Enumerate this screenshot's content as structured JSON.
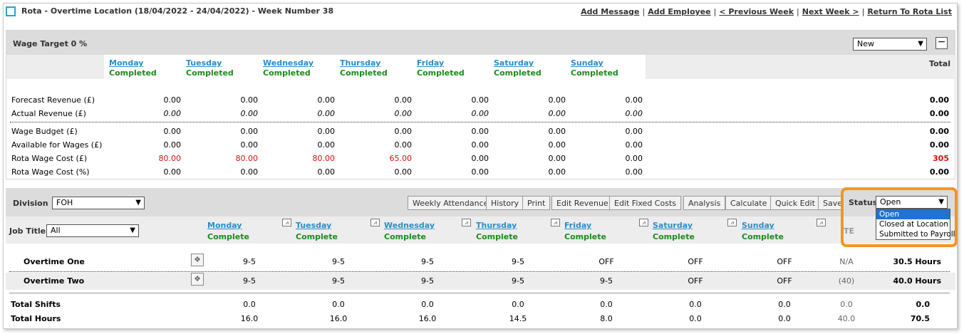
{
  "header": {
    "title": "Rota - Overtime Location (18/04/2022 - 24/04/2022) - Week Number 38",
    "links": [
      "Add Message",
      "Add Employee",
      "< Previous Week",
      "Next Week >",
      "Return To Rota List"
    ]
  },
  "wage_panel": {
    "title": "Wage Target 0 %",
    "view_select": "New",
    "minimize_symbol": "−",
    "total_label": "Total",
    "days": [
      {
        "name": "Monday",
        "status": "Completed"
      },
      {
        "name": "Tuesday",
        "status": "Completed"
      },
      {
        "name": "Wednesday",
        "status": "Completed"
      },
      {
        "name": "Thursday",
        "status": "Completed"
      },
      {
        "name": "Friday",
        "status": "Completed"
      },
      {
        "name": "Saturday",
        "status": "Completed"
      },
      {
        "name": "Sunday",
        "status": "Completed"
      }
    ],
    "rows": [
      {
        "label": "Forecast Revenue (£)",
        "values": [
          "0.00",
          "0.00",
          "0.00",
          "0.00",
          "0.00",
          "0.00",
          "0.00"
        ],
        "total": "0.00"
      },
      {
        "label": "Actual Revenue (£)",
        "values": [
          "0.00",
          "0.00",
          "0.00",
          "0.00",
          "0.00",
          "0.00",
          "0.00"
        ],
        "total": "0.00"
      },
      {
        "label": "Wage Budget (£)",
        "values": [
          "0.00",
          "0.00",
          "0.00",
          "0.00",
          "0.00",
          "0.00",
          "0.00"
        ],
        "total": "0.00"
      },
      {
        "label": "Available for Wages (£)",
        "values": [
          "0.00",
          "0.00",
          "0.00",
          "0.00",
          "0.00",
          "0.00",
          "0.00"
        ],
        "total": "0.00"
      },
      {
        "label": "Rota Wage Cost (£)",
        "values": [
          "80.00",
          "80.00",
          "80.00",
          "65.00",
          "0.00",
          "0.00",
          "0.00"
        ],
        "total": "305"
      },
      {
        "label": "Rota Wage Cost (%)",
        "values": [
          "0.00",
          "0.00",
          "0.00",
          "0.00",
          "0.00",
          "0.00",
          "0.00"
        ],
        "total": "0.00"
      }
    ]
  },
  "rota_panel": {
    "division_label": "Division",
    "division_value": "FOH",
    "buttons": [
      "Weekly Attendance",
      "History",
      "Print",
      "Edit Revenue",
      "Edit Fixed Costs",
      "Analysis",
      "Calculate",
      "Quick Edit",
      "Save"
    ],
    "status_label": "Status",
    "status_value": "Open",
    "status_options": [
      "Open",
      "Closed at Location",
      "Submitted to Payroll"
    ],
    "job_title_label": "Job Title",
    "job_title_value": "All",
    "te_label": "TE",
    "days": [
      {
        "name": "Monday",
        "status": "Complete"
      },
      {
        "name": "Tuesday",
        "status": "Complete"
      },
      {
        "name": "Wednesday",
        "status": "Complete"
      },
      {
        "name": "Thursday",
        "status": "Complete"
      },
      {
        "name": "Friday",
        "status": "Complete"
      },
      {
        "name": "Saturday",
        "status": "Complete"
      },
      {
        "name": "Sunday",
        "status": "Complete"
      }
    ],
    "employees": [
      {
        "name": "Overtime One",
        "shifts": [
          "9-5",
          "9-5",
          "9-5",
          "9-5",
          "OFF",
          "OFF",
          "OFF"
        ],
        "te": "N/A",
        "hours": "30.5 Hours"
      },
      {
        "name": "Overtime Two",
        "shifts": [
          "9-5",
          "9-5",
          "9-5",
          "9-5",
          "9-5",
          "OFF",
          "OFF"
        ],
        "te": "(40)",
        "hours": "40.0 Hours"
      }
    ],
    "totals": [
      {
        "label": "Total Shifts",
        "values": [
          "0.0",
          "0.0",
          "0.0",
          "0.0",
          "0.0",
          "0.0",
          "0.0"
        ],
        "te": "0.0",
        "total": "0.0"
      },
      {
        "label": "Total Hours",
        "values": [
          "16.0",
          "16.0",
          "16.0",
          "14.5",
          "8.0",
          "0.0",
          "0.0"
        ],
        "te": "40.0",
        "total": "70.5"
      }
    ]
  },
  "colors": {
    "accent_link": "#2a8cc7",
    "complete": "#1b8a1b",
    "negative": "#d01010",
    "highlight": "#f7941d",
    "selected_option": "#1e74d0"
  }
}
